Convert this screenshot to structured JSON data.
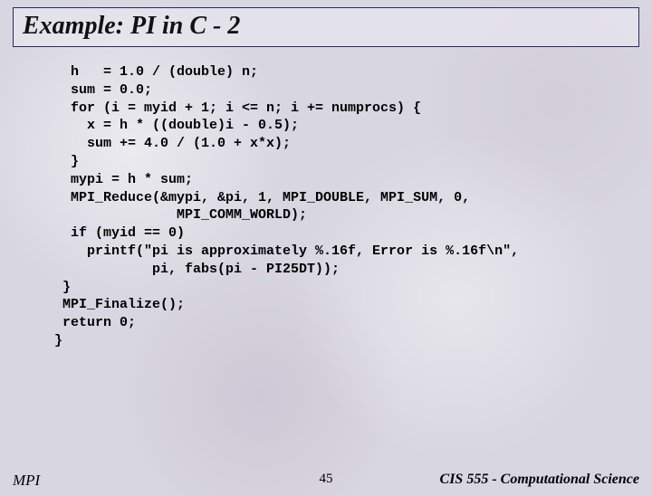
{
  "title": "Example:  PI in C - 2",
  "code": "  h   = 1.0 / (double) n;\n  sum = 0.0;\n  for (i = myid + 1; i <= n; i += numprocs) {\n    x = h * ((double)i - 0.5);\n    sum += 4.0 / (1.0 + x*x);\n  }\n  mypi = h * sum;\n  MPI_Reduce(&mypi, &pi, 1, MPI_DOUBLE, MPI_SUM, 0,\n               MPI_COMM_WORLD);\n  if (myid == 0)\n    printf(\"pi is approximately %.16f, Error is %.16f\\n\",\n            pi, fabs(pi - PI25DT));\n }\n MPI_Finalize();\n return 0;\n}",
  "footer": {
    "left": "MPI",
    "center": "45",
    "right": "CIS 555 - Computational Science"
  }
}
